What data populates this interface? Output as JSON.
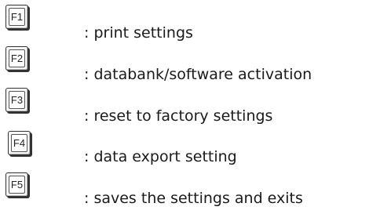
{
  "keys": [
    {
      "key": "F1",
      "separator": ":",
      "description": "print settings"
    },
    {
      "key": "F2",
      "separator": ":",
      "description": "databank/software activation"
    },
    {
      "key": "F3",
      "separator": ":",
      "description": "reset to factory settings"
    },
    {
      "key": "F4",
      "separator": ":",
      "description": "data export setting"
    },
    {
      "key": "F5",
      "separator": ":",
      "description": "saves the settings and exits"
    }
  ]
}
